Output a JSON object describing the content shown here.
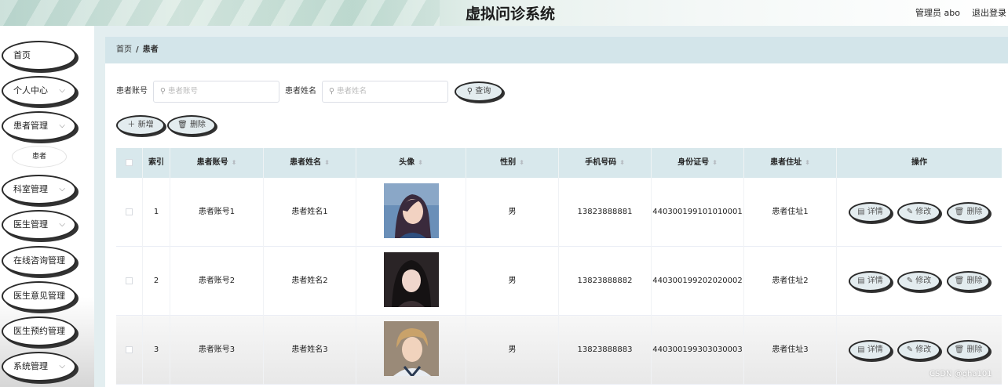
{
  "header": {
    "title": "虚拟问诊系统",
    "admin_label": "管理员 abo",
    "logout": "退出登录"
  },
  "sidebar": {
    "items": [
      {
        "label": "首页",
        "chevron": false
      },
      {
        "label": "个人中心",
        "chevron": true
      },
      {
        "label": "患者管理",
        "chevron": true
      },
      {
        "label": "患者",
        "chevron": false,
        "sub": true
      },
      {
        "label": "科室管理",
        "chevron": true
      },
      {
        "label": "医生管理",
        "chevron": true
      },
      {
        "label": "在线咨询管理",
        "chevron": false
      },
      {
        "label": "医生意见管理",
        "chevron": false
      },
      {
        "label": "医生预约管理",
        "chevron": false
      },
      {
        "label": "系统管理",
        "chevron": true
      }
    ]
  },
  "breadcrumb": {
    "home": "首页",
    "separator": "/",
    "current": "患者"
  },
  "search": {
    "account_label": "患者账号",
    "account_placeholder": "患者账号",
    "name_label": "患者姓名",
    "name_placeholder": "患者姓名",
    "query_button": "查询"
  },
  "actions": {
    "add": "新增",
    "delete": "删除"
  },
  "table": {
    "columns": [
      "索引",
      "患者账号",
      "患者姓名",
      "头像",
      "性别",
      "手机号码",
      "身份证号",
      "患者住址",
      "操作"
    ],
    "rows": [
      {
        "index": "1",
        "account": "患者账号1",
        "name": "患者姓名1",
        "gender": "男",
        "phone": "13823888881",
        "id_number": "440300199101010001",
        "address": "患者住址1"
      },
      {
        "index": "2",
        "account": "患者账号2",
        "name": "患者姓名2",
        "gender": "男",
        "phone": "13823888882",
        "id_number": "440300199202020002",
        "address": "患者住址2"
      },
      {
        "index": "3",
        "account": "患者账号3",
        "name": "患者姓名3",
        "gender": "男",
        "phone": "13823888883",
        "id_number": "440300199303030003",
        "address": "患者住址3"
      }
    ],
    "row_actions": {
      "detail": "详情",
      "edit": "修改",
      "delete": "删除"
    }
  },
  "watermark": "CSDN @qha101",
  "colors": {
    "header_bg": "#d9e9e2",
    "breadcrumb_bg": "#d3e5ea",
    "table_header_bg": "#d8e8ec",
    "button_bg": "#e3ecef"
  }
}
